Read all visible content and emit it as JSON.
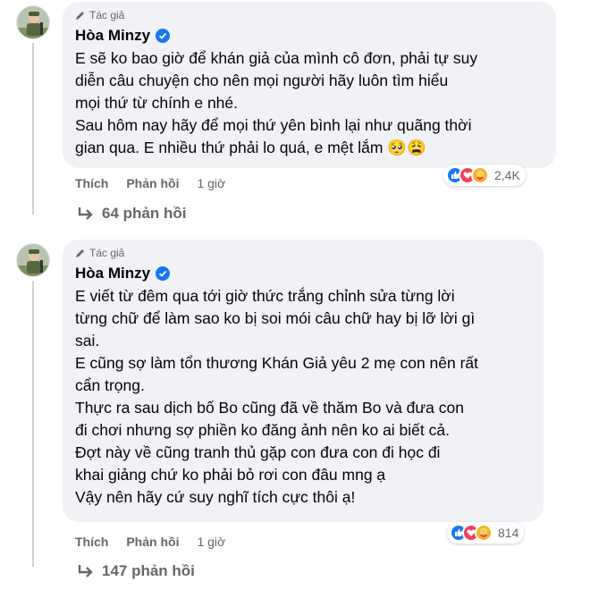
{
  "comments": [
    {
      "badge": "Tác giả",
      "author": "Hòa Minzy",
      "paragraphs": [
        "E sẽ ko bao giờ để khán giả của mình cô đơn, phải tự suy\ndiễn câu chuyện cho nên mọi người hãy luôn tìm hiểu\nmọi thứ từ chính e nhé.",
        "Sau hôm nay hãy để mọi thứ yên bình lại như quãng thời\ngian qua. E nhiều thứ phải lo quá, e mệt lắm 🥺😩"
      ],
      "reaction_count": "2,4K",
      "like_label": "Thích",
      "reply_label": "Phản hồi",
      "time": "1 giờ",
      "replies_label": "64 phản hồi"
    },
    {
      "badge": "Tác giả",
      "author": "Hòa Minzy",
      "paragraphs": [
        "E viết từ đêm qua tới giờ thức trắng chỉnh sửa từng lời\ntừng chữ để làm sao ko bị soi mói câu chữ hay bị lỡ lời gì\nsai.",
        "E cũng sợ làm tổn thương Khán Giả yêu 2 mẹ con nên rất\ncẩn trọng.",
        "Thực ra sau dịch bố Bo cũng đã về thăm Bo và đưa con\nđi chơi nhưng sợ phiền ko đăng ảnh nên ko ai biết cả.",
        "Đợt này về cũng tranh thủ gặp con đưa con đi học đi\nkhai giảng chứ ko phải bỏ rơi con đâu mng ạ",
        "Vậy nên hãy cứ suy nghĩ tích cực thôi ạ!"
      ],
      "reaction_count": "814",
      "like_label": "Thích",
      "reply_label": "Phản hồi",
      "time": "1 giờ",
      "replies_label": "147 phản hồi"
    }
  ],
  "colors": {
    "bubble": "#f0f2f5",
    "secondary_text": "#65676b",
    "like_blue": "#1877f2",
    "love_red": "#f33e58",
    "care_yellow": "#f7b125"
  }
}
